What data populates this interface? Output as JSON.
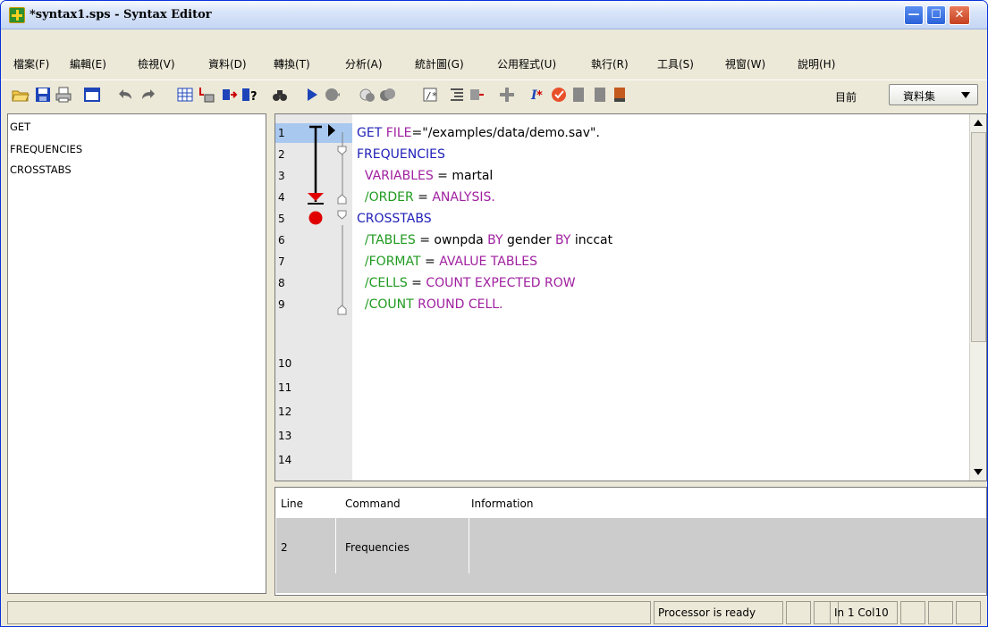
{
  "window": {
    "title": "*syntax1.sps - Syntax Editor"
  },
  "menu": [
    "檔案(F)",
    "編輯(E)",
    "檢視(V)",
    "資料(D)",
    "轉換(T)",
    "分析(A)",
    "統計圖(G)",
    "公用程式(U)",
    "執行(R)",
    "工具(S)",
    "視窗(W)",
    "說明(H)"
  ],
  "toolbar": {
    "current_label": "目前",
    "dataset_label": "資料集"
  },
  "navigator": {
    "items": [
      "GET",
      "FREQUENCIES",
      "CROSSTABS"
    ]
  },
  "editor": {
    "line_numbers": [
      "1",
      "2",
      "3",
      "4",
      "5",
      "6",
      "7",
      "8",
      "9",
      "10",
      "11",
      "12",
      "13",
      "14"
    ],
    "breakpoint_line": 5
  },
  "errors": {
    "headers": [
      "Line",
      "Command",
      "Information"
    ],
    "rows": [
      {
        "line": "2",
        "command": "Frequencies",
        "information": ""
      }
    ]
  },
  "statusbar": {
    "processor": "Processor is ready",
    "position": "In 1 Col10"
  }
}
